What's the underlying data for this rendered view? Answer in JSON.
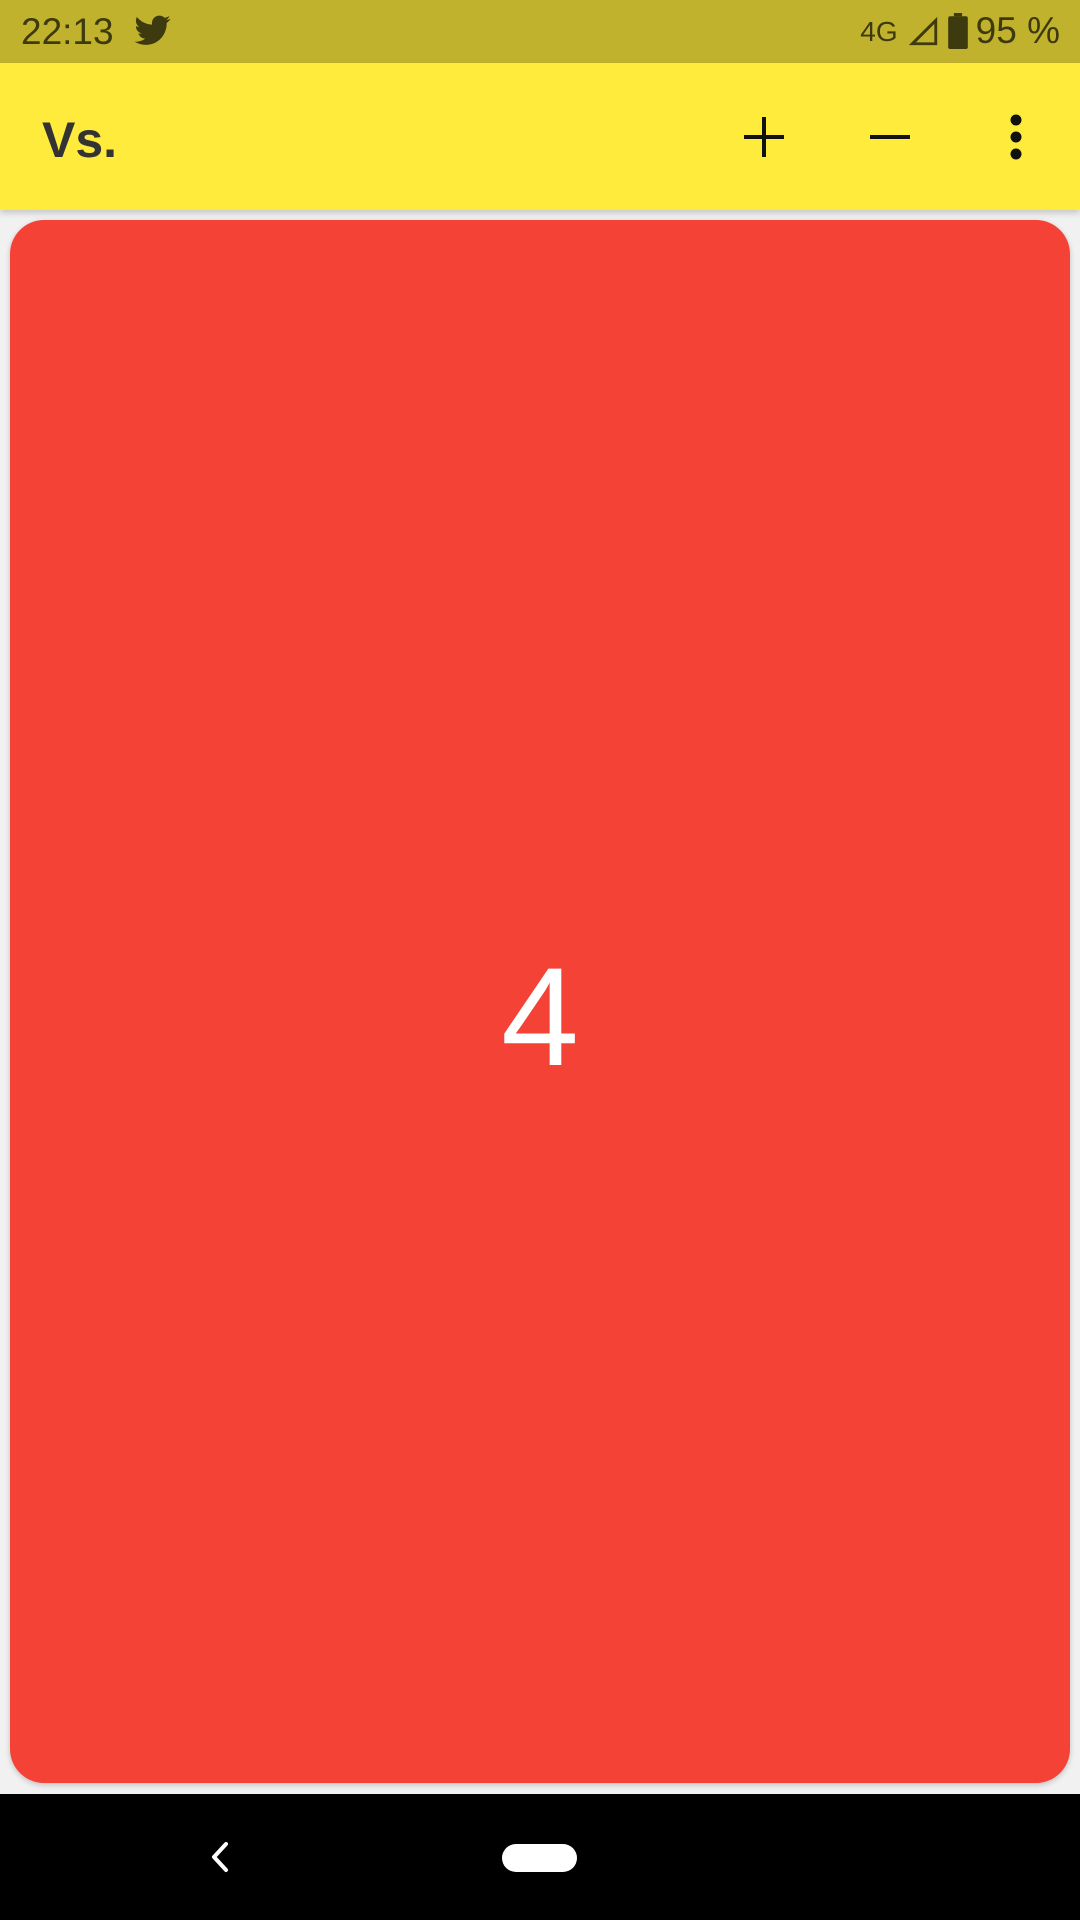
{
  "status_bar": {
    "time": "22:13",
    "notification_icon": "twitter-icon",
    "network": "4G",
    "battery_percent": "95 %"
  },
  "app_bar": {
    "title": "Vs.",
    "actions": [
      "add-icon",
      "remove-icon",
      "more-vert-icon"
    ]
  },
  "counter": {
    "value": "4",
    "card_color": "#f44336"
  },
  "nav_bar": {
    "buttons": [
      "back-icon",
      "home-pill"
    ]
  },
  "colors": {
    "status_bar": "#c1b22d",
    "app_bar": "#ffeb3b",
    "card": "#f44336"
  }
}
